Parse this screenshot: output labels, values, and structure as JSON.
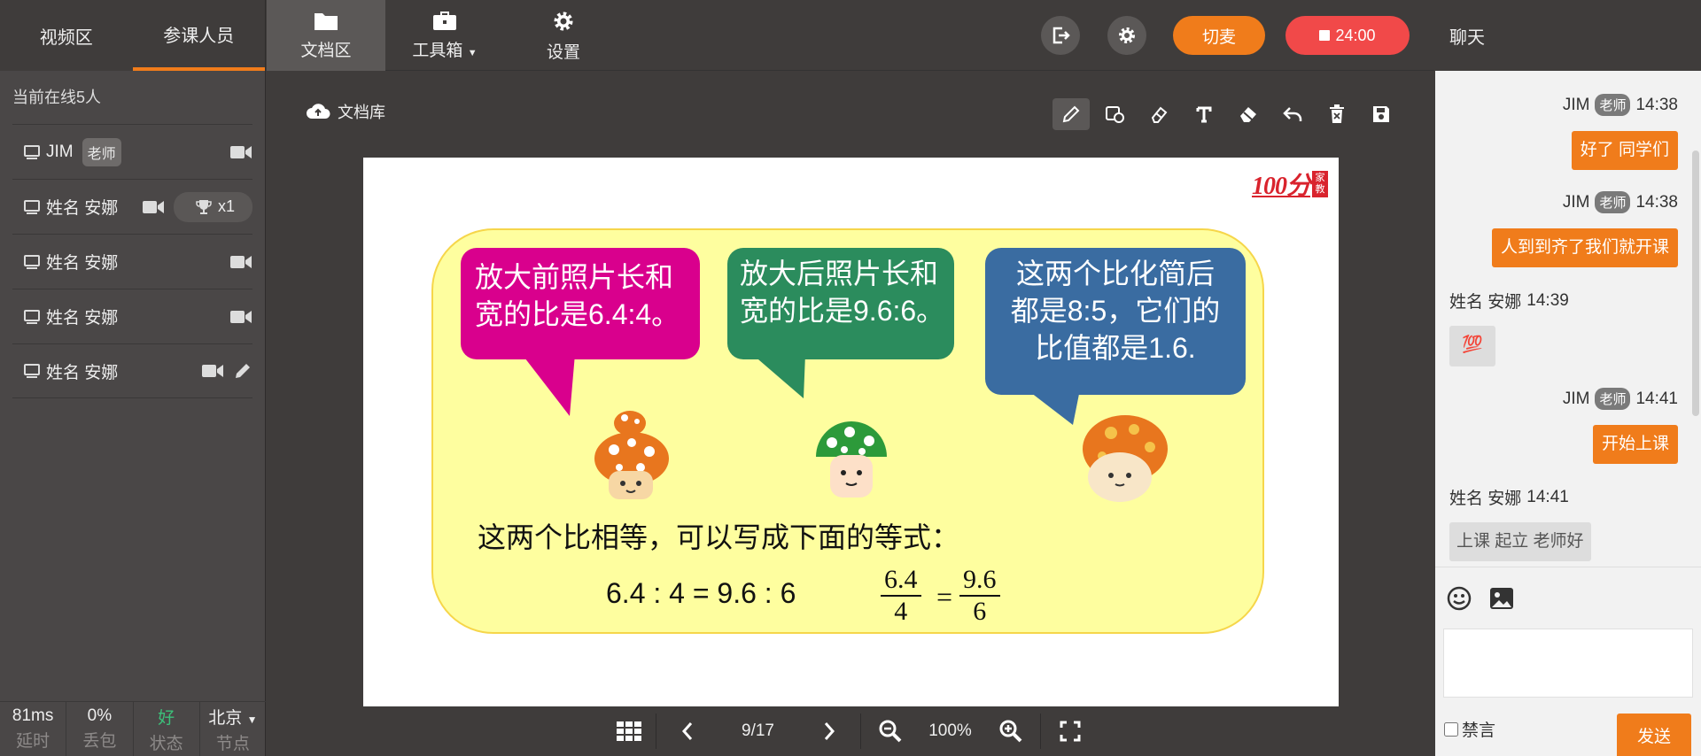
{
  "left_panel": {
    "tabs": [
      "视频区",
      "参课人员"
    ],
    "online_count": "当前在线5人",
    "users": [
      {
        "name": "JIM",
        "role": "老师"
      },
      {
        "name": "姓名 安娜",
        "trophy": "x1"
      },
      {
        "name": "姓名 安娜"
      },
      {
        "name": "姓名 安娜"
      },
      {
        "name": "姓名 安娜"
      }
    ],
    "stats": [
      {
        "value": "81ms",
        "label": "延时"
      },
      {
        "value": "0%",
        "label": "丢包"
      },
      {
        "value": "好",
        "label": "状态"
      },
      {
        "value": "北京",
        "label": "节点"
      }
    ]
  },
  "topbar": {
    "nav": [
      "文档区",
      "工具箱",
      "设置"
    ],
    "switch_label": "切麦",
    "timer": "24:00"
  },
  "doc": {
    "library_label": "文档库",
    "tools": [
      "pen",
      "shapes",
      "eraser",
      "text",
      "clear",
      "undo",
      "delete",
      "save"
    ],
    "slide": {
      "logo": "100分",
      "logo_side": "家教",
      "bubble1": [
        "放大前照片长和",
        "宽的比是6.4:4。"
      ],
      "bubble2": [
        "放大后照片长和",
        "宽的比是9.6:6。"
      ],
      "bubble3": [
        "这两个比化简后",
        "都是8:5，它们的",
        "比值都是1.6."
      ],
      "equation_text": "这两个比相等，可以写成下面的等式：",
      "equation1": "6.4 : 4 = 9.6 : 6",
      "frac_left": {
        "num": "6.4",
        "den": "4"
      },
      "equals": "=",
      "frac_right": {
        "num": "9.6",
        "den": "6"
      }
    },
    "pager": {
      "page": "9/17",
      "zoom": "100%"
    }
  },
  "chat": {
    "title": "聊天",
    "teacher_tag": "老师",
    "messages": [
      {
        "sender": "JIM",
        "time": "14:38",
        "text": "好了 同学们"
      },
      {
        "sender": "JIM",
        "time": "14:38",
        "text": "人到到齐了我们就开课"
      },
      {
        "sender": "姓名 安娜",
        "time": "14:39",
        "text": "💯"
      },
      {
        "sender": "JIM",
        "time": "14:41",
        "text": "开始上课"
      },
      {
        "sender": "姓名 安娜",
        "time": "14:41",
        "text": "上课 起立 老师好"
      }
    ],
    "mute_label": "禁言",
    "send_label": "发送"
  },
  "colors": {
    "accent": "#f07c1b",
    "danger": "#f14949",
    "status_good": "#3cc07a"
  }
}
